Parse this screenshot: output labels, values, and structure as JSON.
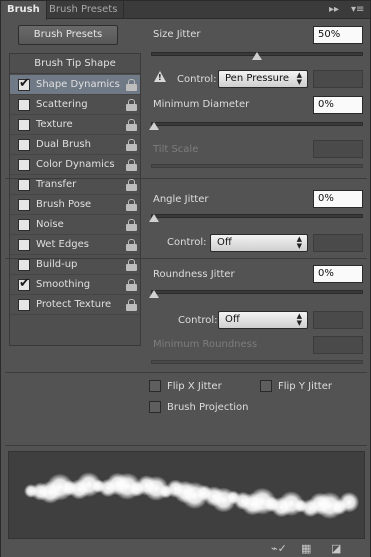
{
  "tabs": [
    {
      "label": "Brush",
      "active": true
    },
    {
      "label": "Brush Presets",
      "active": false
    }
  ],
  "tab_controls": {
    "collapse_icon": "double-chevron-right-icon",
    "menu_icon": "panel-menu-icon",
    "collapse_glyph": "▸▸",
    "menu_glyph": "▾≡"
  },
  "left": {
    "presets_button": "Brush Presets",
    "tip_shape_label": "Brush Tip Shape",
    "items": [
      {
        "label": "Shape Dynamics",
        "checked": true,
        "selected": true
      },
      {
        "label": "Scattering",
        "checked": false,
        "selected": false
      },
      {
        "label": "Texture",
        "checked": false,
        "selected": false
      },
      {
        "label": "Dual Brush",
        "checked": false,
        "selected": false
      },
      {
        "label": "Color Dynamics",
        "checked": false,
        "selected": false
      },
      {
        "label": "Transfer",
        "checked": false,
        "selected": false
      },
      {
        "label": "Brush Pose",
        "checked": false,
        "selected": false
      },
      {
        "label": "Noise",
        "checked": false,
        "selected": false
      },
      {
        "label": "Wet Edges",
        "checked": false,
        "selected": false
      },
      {
        "label": "Build-up",
        "checked": false,
        "selected": false
      },
      {
        "label": "Smoothing",
        "checked": true,
        "selected": false
      },
      {
        "label": "Protect Texture",
        "checked": false,
        "selected": false
      }
    ]
  },
  "right": {
    "size_jitter": {
      "label": "Size Jitter",
      "value": "50%",
      "slider_fraction": 0.5
    },
    "size_control": {
      "label": "Control:",
      "value": "Pen Pressure",
      "warning_icon": "warning-icon"
    },
    "min_diameter": {
      "label": "Minimum Diameter",
      "value": "0%",
      "slider_fraction": 0.0
    },
    "tilt_scale": {
      "label": "Tilt Scale",
      "value": ""
    },
    "angle_jitter": {
      "label": "Angle Jitter",
      "value": "0%",
      "slider_fraction": 0.0
    },
    "angle_control": {
      "label": "Control:",
      "value": "Off"
    },
    "roundness_jitter": {
      "label": "Roundness Jitter",
      "value": "0%",
      "slider_fraction": 0.0
    },
    "roundness_control": {
      "label": "Control:",
      "value": "Off"
    },
    "min_roundness": {
      "label": "Minimum Roundness",
      "value": ""
    },
    "flip_x": {
      "label": "Flip X Jitter",
      "checked": false
    },
    "flip_y": {
      "label": "Flip Y Jitter",
      "checked": false
    },
    "brush_projection": {
      "label": "Brush Projection",
      "checked": false
    }
  },
  "preview": {
    "icon": "brush-stroke-preview"
  },
  "bottom_bar": {
    "icons": [
      "toggle-live-tip-preview-icon",
      "open-preset-manager-icon",
      "create-new-brush-icon"
    ]
  },
  "colors": {
    "panel_bg": "#535353",
    "selected_row": "#6f7a86",
    "tab_bar": "#3b3b3b"
  }
}
